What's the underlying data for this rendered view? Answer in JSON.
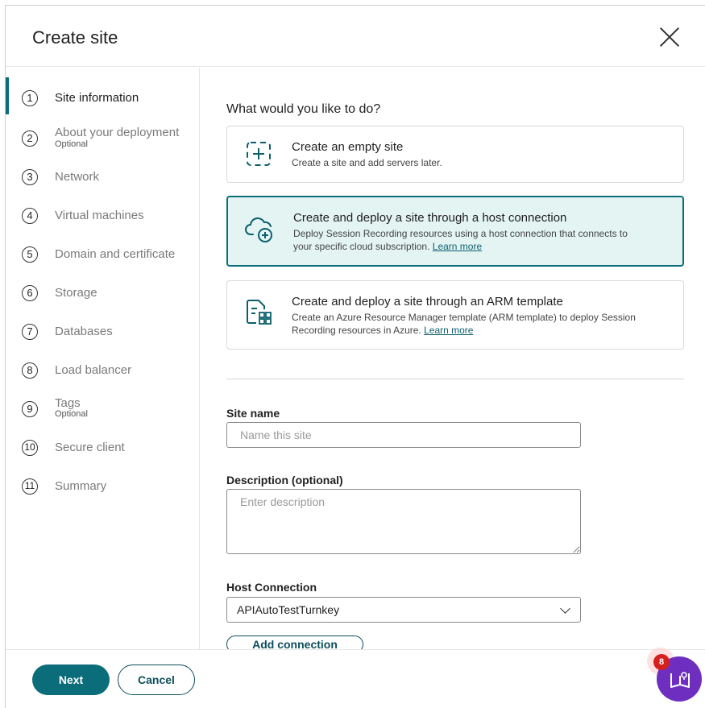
{
  "dialog": {
    "title": "Create site"
  },
  "steps": [
    {
      "num": "1",
      "label": "Site information",
      "optional": ""
    },
    {
      "num": "2",
      "label": "About your deployment",
      "optional": "Optional"
    },
    {
      "num": "3",
      "label": "Network",
      "optional": ""
    },
    {
      "num": "4",
      "label": "Virtual machines",
      "optional": ""
    },
    {
      "num": "5",
      "label": "Domain and certificate",
      "optional": ""
    },
    {
      "num": "6",
      "label": "Storage",
      "optional": ""
    },
    {
      "num": "7",
      "label": "Databases",
      "optional": ""
    },
    {
      "num": "8",
      "label": "Load balancer",
      "optional": ""
    },
    {
      "num": "9",
      "label": "Tags",
      "optional": "Optional"
    },
    {
      "num": "10",
      "label": "Secure client",
      "optional": ""
    },
    {
      "num": "11",
      "label": "Summary",
      "optional": ""
    }
  ],
  "main": {
    "question": "What would you like to do?",
    "options": [
      {
        "title": "Create an empty site",
        "desc": "Create a site and add servers later.",
        "link": "",
        "icon": "dashed-add-icon",
        "selected": false
      },
      {
        "title": "Create and deploy a site through a host connection",
        "desc1": "Deploy Session Recording resources using a host connection that connects to",
        "desc2": "your specific cloud subscription.",
        "link": "Learn more",
        "icon": "cloud-add-icon",
        "selected": true
      },
      {
        "title": "Create and deploy a site through an ARM template",
        "desc1": "Create an Azure Resource Manager template (ARM template) to deploy Session",
        "desc2": "Recording resources in Azure.",
        "link": "Learn more",
        "icon": "template-icon",
        "selected": false
      }
    ],
    "site_name": {
      "label": "Site name",
      "placeholder": "Name this site",
      "value": ""
    },
    "description": {
      "label": "Description (optional)",
      "placeholder": "Enter description",
      "value": ""
    },
    "host_connection": {
      "label": "Host Connection",
      "value": "APIAutoTestTurnkey"
    },
    "add_connection_label": "Add connection"
  },
  "footer": {
    "next_label": "Next",
    "cancel_label": "Cancel"
  },
  "help": {
    "badge_count": "8",
    "icon": "guide-book-icon"
  },
  "colors": {
    "accent": "#0b6c7a",
    "selected_bg": "#e3f4f3",
    "help_purple": "#6e2fc0",
    "badge_red": "#d61f1f"
  }
}
